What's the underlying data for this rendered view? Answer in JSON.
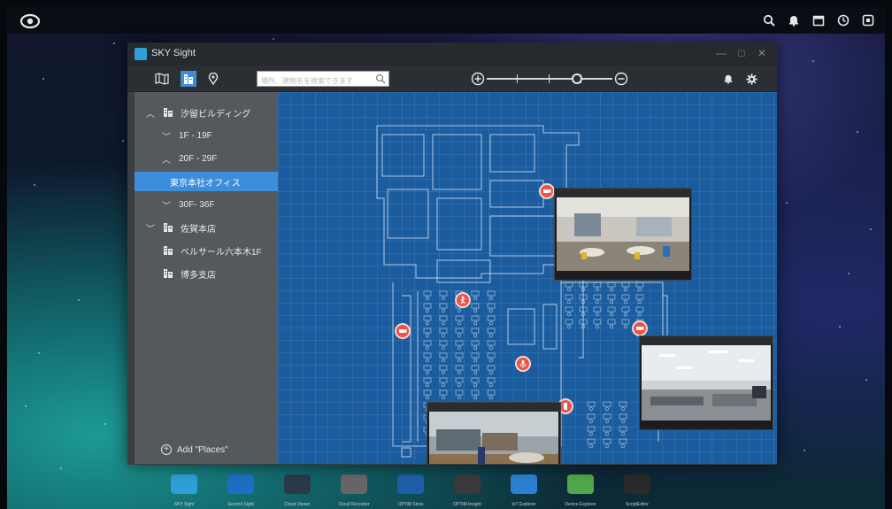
{
  "app": {
    "title": "SKY Sight"
  },
  "toolbar": {
    "search_placeholder": "場所、建物名を検索できます"
  },
  "tree": [
    {
      "label": "汐留ビルディング",
      "level": 0,
      "chevron": "up",
      "icon": "building-icon"
    },
    {
      "label": "1F - 19F",
      "level": 1,
      "chevron": "down"
    },
    {
      "label": "20F - 29F",
      "level": 1,
      "chevron": "up"
    },
    {
      "label": "東京本社オフィス",
      "level": 2,
      "selected": true
    },
    {
      "label": "30F- 36F",
      "level": 1,
      "chevron": "down"
    },
    {
      "label": "佐賀本店",
      "level": 0,
      "chevron": "down",
      "icon": "building-icon"
    },
    {
      "label": "ベルサール六本木1F",
      "level": 0,
      "icon": "building-icon"
    },
    {
      "label": "博多支店",
      "level": 0,
      "icon": "building-icon"
    }
  ],
  "sidebar": {
    "add_places": "Add \"Places\""
  },
  "zoom": {
    "level": 0.72
  },
  "dock": [
    {
      "label": "SKY Sight",
      "color": "#2f9fd8"
    },
    {
      "label": "Second Sight",
      "color": "#1e6fc4"
    },
    {
      "label": "Cloud Viewer",
      "color": "#2a3a4a"
    },
    {
      "label": "Cloud Recorder",
      "color": "#666666"
    },
    {
      "label": "OPTiM Store",
      "color": "#1d5fa8"
    },
    {
      "label": "OPTiM Insight",
      "color": "#3a3a3a"
    },
    {
      "label": "IoT Explorer",
      "color": "#2c7fd1"
    },
    {
      "label": "Device Explorer",
      "color": "#4fa84a"
    },
    {
      "label": "ScriptEditor",
      "color": "#2a2a2a"
    }
  ],
  "colors": {
    "accent": "#3c8edb",
    "map_bg": "#1b5c9e",
    "pin": "#e8534a"
  }
}
